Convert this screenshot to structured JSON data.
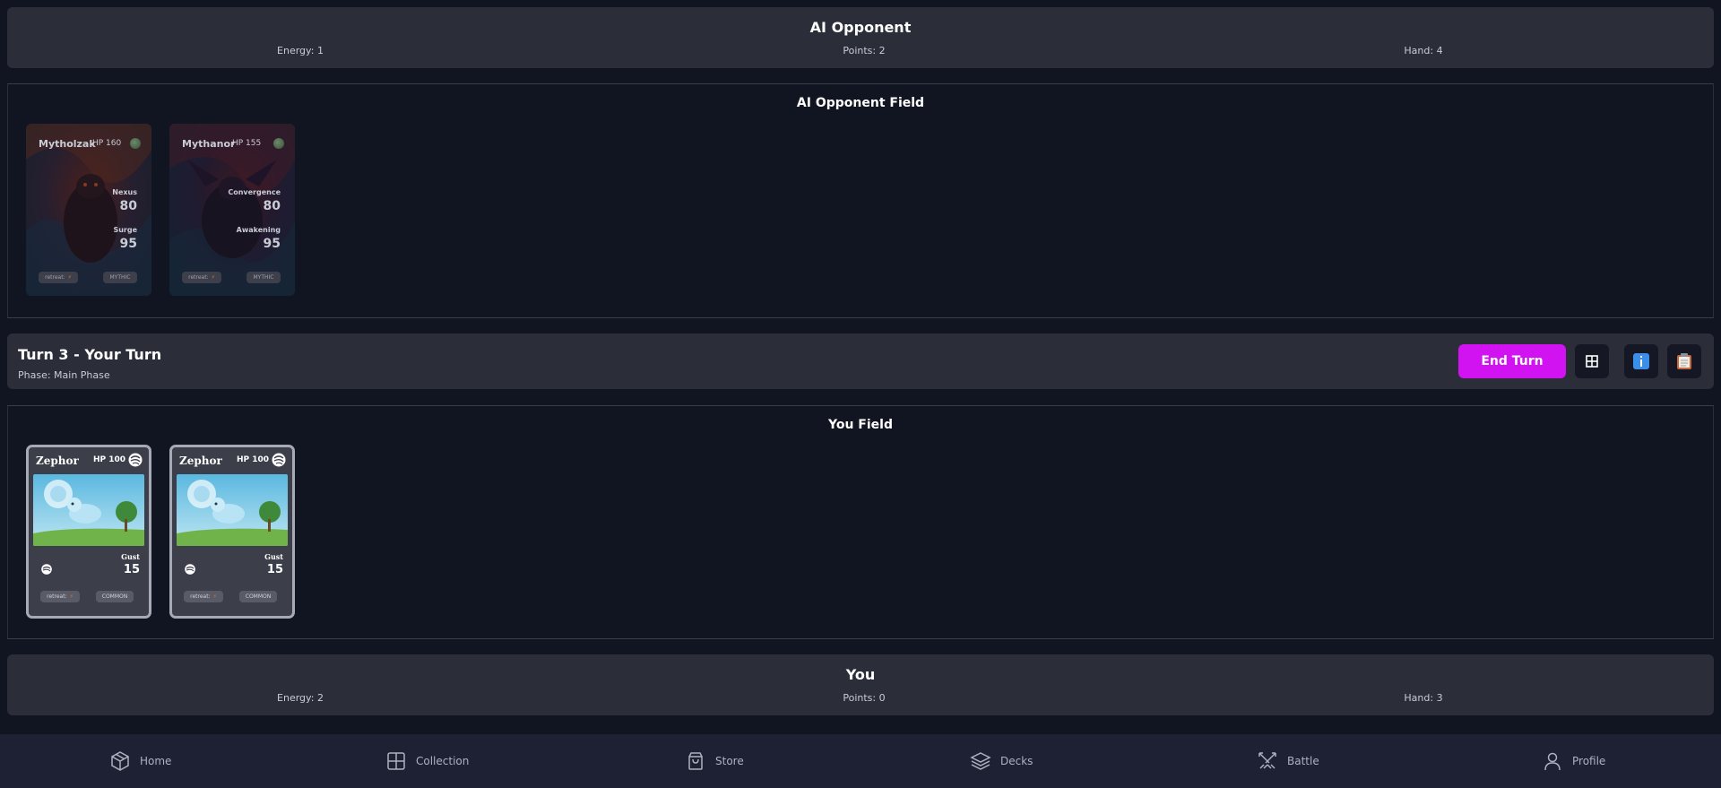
{
  "opponent": {
    "title": "AI Opponent",
    "energy": "Energy: 1",
    "points": "Points: 2",
    "hand": "Hand: 4"
  },
  "opponent_field": {
    "title": "AI Opponent Field",
    "cards": [
      {
        "name": "Mytholzak",
        "hp": "HP 160",
        "attack1_name": "Nexus",
        "attack1_value": "80",
        "attack2_name": "Surge",
        "attack2_value": "95",
        "retreat": "retreat:",
        "rarity": "MYTHIC"
      },
      {
        "name": "Mythanor",
        "hp": "HP 155",
        "attack1_name": "Convergence",
        "attack1_value": "80",
        "attack2_name": "Awakening",
        "attack2_value": "95",
        "retreat": "retreat:",
        "rarity": "MYTHIC"
      }
    ]
  },
  "turn": {
    "title": "Turn 3 - Your Turn",
    "phase": "Phase: Main Phase",
    "end_turn_label": "End Turn"
  },
  "player_field": {
    "title": "You Field",
    "cards": [
      {
        "name": "Zephor",
        "hp": "HP 100",
        "attack_name": "Gust",
        "attack_value": "15",
        "retreat": "retreat:",
        "rarity": "COMMON"
      },
      {
        "name": "Zephor",
        "hp": "HP 100",
        "attack_name": "Gust",
        "attack_value": "15",
        "retreat": "retreat:",
        "rarity": "COMMON"
      }
    ]
  },
  "player": {
    "title": "You",
    "energy": "Energy: 2",
    "points": "Points: 0",
    "hand": "Hand: 3"
  },
  "nav": {
    "items": [
      {
        "label": "Home",
        "icon": "box-icon"
      },
      {
        "label": "Collection",
        "icon": "grid-icon"
      },
      {
        "label": "Store",
        "icon": "bag-icon"
      },
      {
        "label": "Decks",
        "icon": "layers-icon"
      },
      {
        "label": "Battle",
        "icon": "swords-icon"
      },
      {
        "label": "Profile",
        "icon": "user-icon"
      }
    ]
  },
  "colors": {
    "accent": "#d013f0",
    "background": "#111421",
    "panel": "#2b2e39",
    "nav": "#1e2033"
  }
}
